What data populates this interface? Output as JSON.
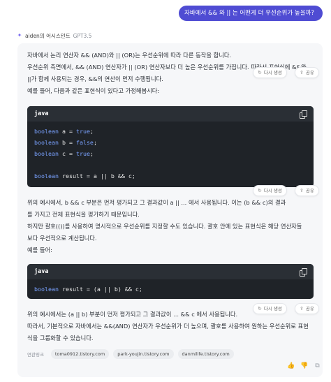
{
  "user_message": "자바에서 && 와 || 는 어떤게 더 우선순위가 높을까?",
  "assistant": {
    "name": "aiden의 어시스턴트",
    "model": "GPT3.5"
  },
  "answer": {
    "intro": [
      "자바에서 논리 연산자 && (AND)와 || (OR)는 우선순위에 따라 다른 동작을 합니다.",
      "우선순위 측면에서, && (AND) 연산자가 || (OR) 연산자보다 더 높은 우선순위를 가집니다. 따라서 표현식에 &&와",
      "||가 함께 사용되는 경우, &&의 연산이 먼저 수행됩니다.",
      "예를 들어, 다음과 같은 표현식이 있다고 가정해봅시다:"
    ],
    "code1": {
      "lang": "java",
      "lines": [
        {
          "kw": "boolean",
          "rest": " a = ",
          "val": "true",
          "end": ";"
        },
        {
          "kw": "boolean",
          "rest": " b = ",
          "val": "false",
          "end": ";"
        },
        {
          "kw": "boolean",
          "rest": " c = ",
          "val": "true",
          "end": ";"
        },
        {
          "kw": "",
          "rest": "",
          "val": "",
          "end": ""
        },
        {
          "kw": "boolean",
          "rest": " result = a || b && c;",
          "val": "",
          "end": ""
        }
      ]
    },
    "explain1": [
      "위의 예시에서, b && c 부분은 먼저 평가되고 그 결과값이 a || ... 에서 사용됩니다. 이는 (b && c)의 결과",
      "를 가지고 전체 표현식을 평가하기 때문입니다.",
      "하지만 괄호(())를 사용하여 명시적으로 우선순위를 지정할 수도 있습니다. 괄호 안에 있는 표현식은 해당 연산자들",
      "보다 우선적으로 계산됩니다.",
      "예를 들어:"
    ],
    "code2": {
      "lang": "java",
      "lines": [
        {
          "kw": "boolean",
          "rest": " result = (a || b) && c;",
          "val": "",
          "end": ""
        }
      ]
    },
    "explain2": [
      "위의 예시에서는 (a || b) 부분이 먼저 평가되고 그 결과값이 ... && c 에서 사용됩니다.",
      "따라서, 기본적으로 자바에서는 &&(AND) 연산자가 우선순위가 더 높으며, 괄호를 사용하여 원하는 우선순위로 표현",
      "식을 그룹화할 수 있습니다."
    ]
  },
  "actions": {
    "regenerate": "다시 생성",
    "share": "공유"
  },
  "sources": {
    "label": "연관링크",
    "links": [
      "toma0912.tistory.com",
      "park-youjin.tistory.com",
      "danmilife.tistory.com"
    ]
  },
  "icons": {
    "assistant": "sparkle-icon",
    "copy": "copy-icon",
    "like": "thumbs-up-icon",
    "dislike": "thumbs-down-icon",
    "copy_answer": "copy-icon"
  },
  "colors": {
    "accent": "#4f4cd3",
    "code_bg": "#1f2328",
    "keyword": "#7aa2ff"
  }
}
